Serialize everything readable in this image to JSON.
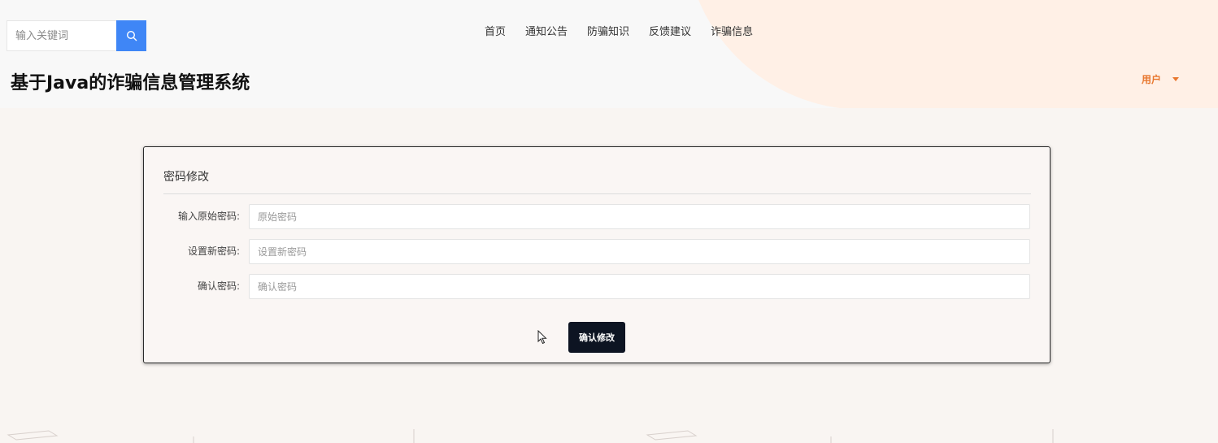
{
  "header": {
    "search": {
      "placeholder": "输入关键词",
      "icon": "search-icon"
    },
    "nav": [
      "首页",
      "通知公告",
      "防骗知识",
      "反馈建议",
      "诈骗信息"
    ],
    "site_title": "基于Java的诈骗信息管理系统",
    "user_menu": {
      "label": "用户",
      "icon": "caret-down-icon"
    }
  },
  "card": {
    "title": "密码修改",
    "fields": [
      {
        "label": "输入原始密码:",
        "placeholder": "原始密码",
        "value": ""
      },
      {
        "label": "设置新密码:",
        "placeholder": "设置新密码",
        "value": ""
      },
      {
        "label": "确认密码:",
        "placeholder": "确认密码",
        "value": ""
      }
    ],
    "submit_label": "确认修改"
  },
  "colors": {
    "accent_blue": "#3f86f6",
    "user_orange": "#e8772e",
    "submit_dark": "#0d1422",
    "header_bg": "#f8f8f8",
    "page_bg": "#f9f5f2"
  }
}
